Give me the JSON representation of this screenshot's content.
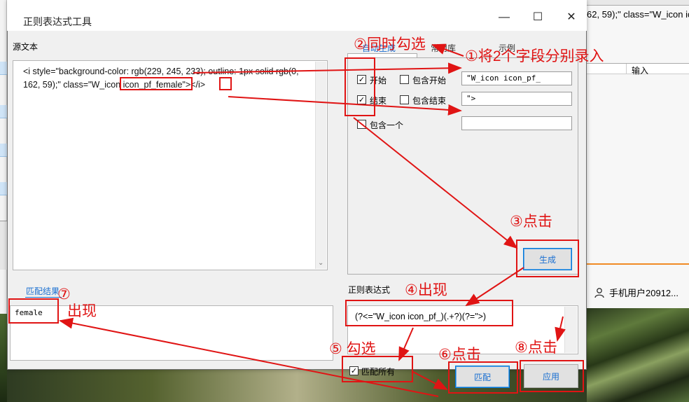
{
  "dialog": {
    "title": "正则表达式工具",
    "minimize_glyph": "—",
    "maximize_glyph": "☐",
    "close_glyph": "✕"
  },
  "source": {
    "label": "源文本",
    "text_before": "<i style=\"background-color: rgb(229, 245, 233); outline: 1px solid rgb(0, 162, 59);\" class=",
    "text_highlight_start": "\"W_icon icon_pf_",
    "text_word": "female",
    "text_highlight_end": "\">",
    "text_after": "</i>"
  },
  "tabs": [
    "自动生成",
    "常用库",
    "示例"
  ],
  "options": {
    "start_label": "开始",
    "start_checked": true,
    "include_start_label": "包含开始",
    "include_start_checked": false,
    "start_value": "\"W_icon icon_pf_",
    "end_label": "结束",
    "end_checked": true,
    "include_end_label": "包含结束",
    "include_end_checked": false,
    "end_value": "\">",
    "contains_label": "包含一个",
    "contains_checked": false,
    "contains_value": ""
  },
  "buttons": {
    "generate": "生成",
    "match": "匹配",
    "apply": "应用"
  },
  "regex": {
    "label": "正则表达式",
    "value": "(?<=\"W_icon icon_pf_)(.+?)(?=\">)"
  },
  "result": {
    "label": "匹配结果",
    "value": "female"
  },
  "match_all": {
    "label": "匹配所有",
    "checked": true
  },
  "background": {
    "right_text": "62, 59);\" class=\"W_icon ic",
    "column_header": "输入",
    "user_label": "手机用户20912..."
  },
  "annotations": {
    "a1": "①将2个字段分别录入",
    "a2": "②同时勾选",
    "a3": "③点击",
    "a4": "④出现",
    "a5": "⑤ 勾选",
    "a6": "⑥点击",
    "a7": "⑦",
    "a7b": "出现",
    "a8": "⑧点击"
  },
  "colors": {
    "annotation_red": "#e01414",
    "accent_blue": "#0078d7",
    "tab_blue": "#1a6fd1"
  }
}
